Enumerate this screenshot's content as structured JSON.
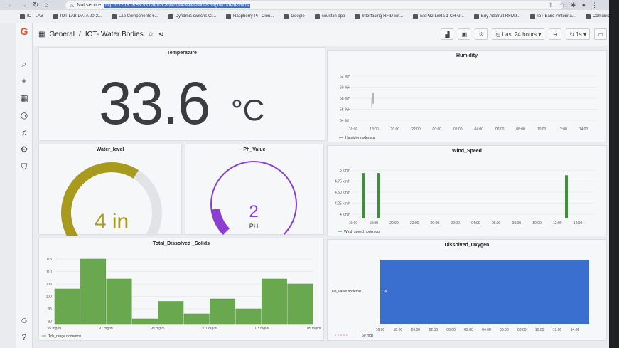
{
  "browser": {
    "nav_icons": [
      "back-icon",
      "forward-icon",
      "reload-icon",
      "home-icon"
    ],
    "not_secure": "Not secure",
    "url": "http://172.16.16.53:3000/d/1i2C8hw7k/iot-water-bodies?orgId=1&refresh=1s",
    "bookmarks": [
      {
        "label": "IOT LAB"
      },
      {
        "label": "IOT LAB DATA 20-2..."
      },
      {
        "label": "Lab Components 6..."
      },
      {
        "label": "Dynamic switchs Cr..."
      },
      {
        "label": "Raspberry Pi - Clou..."
      },
      {
        "label": "Google"
      },
      {
        "label": "count in app"
      },
      {
        "label": "Interfacing RFID wit..."
      },
      {
        "label": "ESP32 LoRa 1-CH G..."
      },
      {
        "label": "Buy Adafruit RFM9..."
      },
      {
        "label": "IoT-Band-Antenna..."
      },
      {
        "label": "Comunicación LoRa..."
      }
    ]
  },
  "header": {
    "section": "General",
    "separator": "/",
    "dashboard": "IOT- Water Bodies",
    "time_range": "Last 24 hours",
    "refresh": "1s"
  },
  "panels": {
    "temperature": {
      "title": "Temperature",
      "value": "33.6",
      "unit": "°C"
    },
    "humidity": {
      "title": "Humidity",
      "legend": "Humidity nodemcu"
    },
    "water_level": {
      "title": "Water_level",
      "value": "4 in",
      "fraction": 0.62,
      "color": "#a89a1c"
    },
    "ph": {
      "title": "Ph_Value",
      "value": "2",
      "unit": "PH",
      "fraction": 0.14,
      "color": "#8a3fd1"
    },
    "wind": {
      "title": "Wind_Speed",
      "legend": "Wind_speed nodemcu"
    },
    "tds": {
      "title": "Total_Dissolved _Solids",
      "legend": "Tds_range nodemcu"
    },
    "do": {
      "title": "Dissolved_Oxygen",
      "series_label": "Do_value nodemcu",
      "legend_b": "60 mg/l",
      "point_label": "Ł-a"
    }
  },
  "colors": {
    "green": "#6aa84f",
    "bar_dark": "#3e8e3a",
    "blue": "#3a6fd0",
    "accent": "#e2512b"
  },
  "chart_data": [
    {
      "type": "line",
      "title": "Humidity",
      "x": [
        "16:00",
        "18:00",
        "20:00",
        "22:00",
        "00:00",
        "02:00",
        "04:00",
        "06:00",
        "08:00",
        "10:00",
        "12:00",
        "14:00"
      ],
      "yticks": [
        "62 %H",
        "60 %H",
        "58 %H",
        "56 %H",
        "54 %H"
      ],
      "ylim": [
        54,
        62
      ],
      "series": [
        {
          "name": "Humidity nodemcu",
          "values": [
            57,
            59
          ]
        }
      ]
    },
    {
      "type": "bar",
      "title": "Wind_Speed",
      "x": [
        "16:00",
        "18:00",
        "20:00",
        "22:00",
        "00:00",
        "02:00",
        "04:00",
        "06:00",
        "08:00",
        "10:00",
        "12:00",
        "14:00"
      ],
      "yticks": [
        "5 km/h",
        "4.75 km/h",
        "4.50 km/h",
        "4.25 km/h",
        "4 km/h"
      ],
      "ylim": [
        4,
        5
      ],
      "series": [
        {
          "name": "Wind_speed nodemcu",
          "values": [
            4.9,
            4.9,
            4.85
          ]
        }
      ]
    },
    {
      "type": "bar",
      "title": "Total_Dissolved _Solids",
      "categories": [
        "95 mg/dL",
        "97 mg/dL",
        "99 mg/dL",
        "101 mg/dL",
        "103 mg/dL",
        "105 mg/dL"
      ],
      "yticks": [
        "115",
        "110",
        "105",
        "100",
        "95",
        "90"
      ],
      "ylim": [
        89,
        117
      ],
      "series": [
        {
          "name": "Tds_range nodemcu",
          "values": [
            103,
            115,
            107,
            91,
            98,
            93,
            99,
            95,
            107,
            105
          ]
        }
      ]
    },
    {
      "type": "area",
      "title": "Dissolved_Oxygen",
      "x": [
        "16:00",
        "18:00",
        "20:00",
        "22:00",
        "00:00",
        "02:00",
        "04:00",
        "06:00",
        "08:00",
        "10:00",
        "12:00",
        "14:00"
      ],
      "series": [
        {
          "name": "Do_value nodemcu",
          "values": [
            60,
            60
          ]
        }
      ]
    }
  ]
}
